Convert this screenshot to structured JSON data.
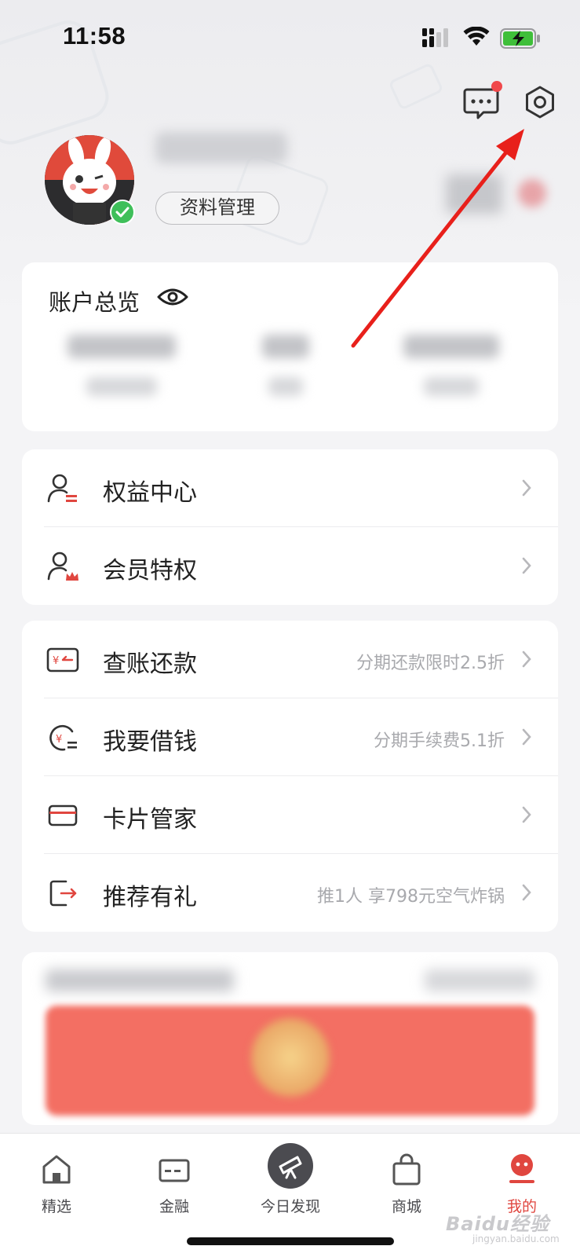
{
  "status_bar": {
    "time": "11:58"
  },
  "header": {
    "profile_button": "资料管理",
    "has_unread_messages": true
  },
  "overview": {
    "title": "账户总览"
  },
  "benefits_section": [
    {
      "label": "权益中心",
      "icon": "user-card-icon",
      "hint": ""
    },
    {
      "label": "会员特权",
      "icon": "user-crown-icon",
      "hint": ""
    }
  ],
  "finance_section": [
    {
      "label": "查账还款",
      "icon": "bill-repay-icon",
      "hint": "分期还款限时2.5折"
    },
    {
      "label": "我要借钱",
      "icon": "borrow-money-icon",
      "hint": "分期手续费5.1折"
    },
    {
      "label": "卡片管家",
      "icon": "card-icon",
      "hint": ""
    },
    {
      "label": "推荐有礼",
      "icon": "share-exit-icon",
      "hint": "推1人 享798元空气炸锅"
    }
  ],
  "tabbar": {
    "items": [
      {
        "label": "精选",
        "icon": "home-icon",
        "active": false
      },
      {
        "label": "金融",
        "icon": "finance-card-icon",
        "active": false
      },
      {
        "label": "今日发现",
        "icon": "telescope-icon",
        "active": false
      },
      {
        "label": "商城",
        "icon": "shopping-bag-icon",
        "active": false
      },
      {
        "label": "我的",
        "icon": "profile-face-icon",
        "active": true
      }
    ]
  },
  "watermark": {
    "brand": "Baidu经验",
    "url": "jingyan.baidu.com"
  },
  "colors": {
    "accent": "#e0463f",
    "annotation": "#e8201b",
    "verified": "#3fbf5a"
  }
}
